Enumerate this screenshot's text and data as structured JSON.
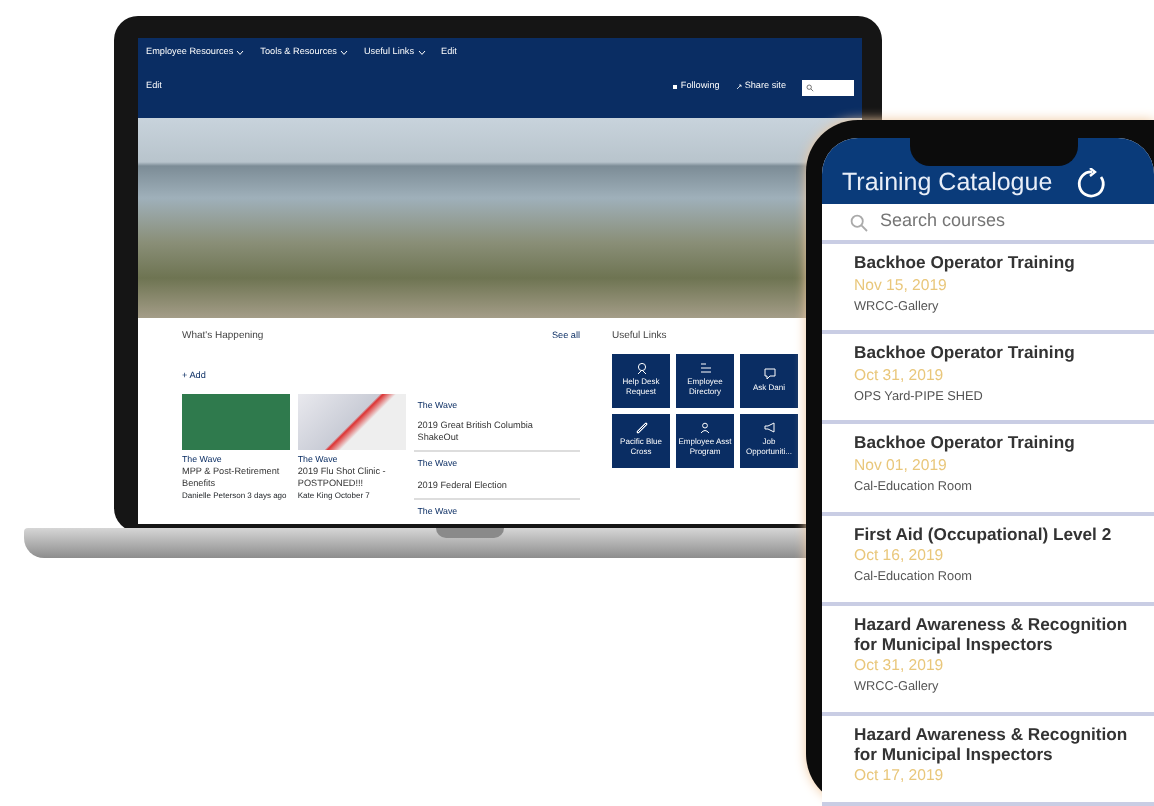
{
  "laptop": {
    "nav_links": [
      {
        "label": "Employee Resources",
        "dropdown": true
      },
      {
        "label": "Tools & Resources",
        "dropdown": true
      },
      {
        "label": "Useful Links",
        "dropdown": true
      },
      {
        "label": "Edit",
        "dropdown": false
      }
    ],
    "edit_link": "Edit",
    "actions": [
      {
        "label": "Following"
      },
      {
        "label": "Share site"
      }
    ],
    "news": {
      "title": "What's Happening",
      "add": "+ Add",
      "see_all": "See all",
      "cards": [
        {
          "kind": "green",
          "source": "The Wave",
          "title": "MPP & Post-Retirement Benefits",
          "author": "Danielle Peterson",
          "time": "3 days ago"
        },
        {
          "kind": "photo",
          "source": "The Wave",
          "title": "2019 Flu Shot Clinic - POSTPONED!!!",
          "author": "Kate King",
          "time": "October 7"
        }
      ],
      "list": [
        {
          "source": "The Wave",
          "title": "2019 Great British Columbia ShakeOut"
        },
        {
          "source": "The Wave",
          "title": "2019 Federal Election"
        },
        {
          "source": "The Wave"
        }
      ]
    },
    "useful_links": {
      "title": "Useful Links",
      "tiles": [
        "Help Desk Request",
        "Employee Directory",
        "Ask Dani",
        "Pacific Blue Cross",
        "Employee Asst Program",
        "Job Opportuniti..."
      ]
    }
  },
  "phone": {
    "title": "Training Catalogue",
    "search": {
      "placeholder": "Search courses"
    },
    "courses": [
      {
        "title": "Backhoe Operator Training",
        "date": "Nov 15, 2019",
        "location": "WRCC-Gallery"
      },
      {
        "title": "Backhoe Operator Training",
        "date": "Oct 31, 2019",
        "location": "OPS Yard-PIPE SHED"
      },
      {
        "title": "Backhoe Operator Training",
        "date": "Nov 01, 2019",
        "location": "Cal-Education Room"
      },
      {
        "title": "First Aid (Occupational) Level 2",
        "date": "Oct 16, 2019",
        "location": "Cal-Education Room"
      },
      {
        "title": "Hazard Awareness & Recognition for Municipal Inspectors",
        "date": "Oct 31, 2019",
        "location": "WRCC-Gallery"
      },
      {
        "title": "Hazard Awareness & Recognition for Municipal Inspectors",
        "date": "Oct 17, 2019"
      }
    ]
  }
}
